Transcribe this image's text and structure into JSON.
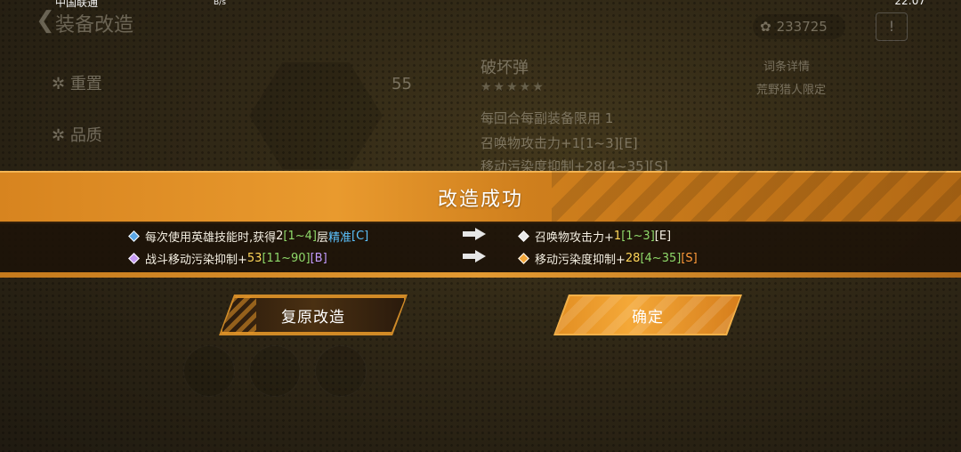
{
  "statusbar": {
    "carrier": "中国联通",
    "net": "B/s",
    "time": "22:07"
  },
  "background": {
    "title": "装备改造",
    "currency": "233725",
    "side_items": [
      "重置",
      "品质"
    ],
    "item_level": "55",
    "item_name": "破坏弹",
    "stars": "★★★★★",
    "detail_label": "词条详情",
    "limit_label": "荒野猎人限定",
    "affix_hint": "每回合每副装备限用 1",
    "affix_1": "召唤物攻击力+1[1~3][E]",
    "affix_2": "移动污染度抑制+28[4~35][S]"
  },
  "banner": {
    "title": "改造成功",
    "rows": [
      {
        "before_prefix": "每次使用英雄技能时,获得",
        "before_num": "2",
        "before_range": "[1~4]",
        "before_mid": "层",
        "before_kw": "精准",
        "before_grade": "[C]",
        "after_prefix": "召唤物攻击力+",
        "after_num": "1",
        "after_range": "[1~3]",
        "after_grade": "[E]"
      },
      {
        "before_prefix": "战斗移动污染抑制+",
        "before_num": "53",
        "before_range": "[11~90]",
        "before_grade": "[B]",
        "after_prefix": "移动污染度抑制+",
        "after_num": "28",
        "after_range": "[4~35]",
        "after_grade": "[S]"
      }
    ]
  },
  "buttons": {
    "restore": "复原改造",
    "confirm": "确定"
  },
  "colors": {
    "accent": "#e99a2e",
    "grade_c": "#5cc3ff",
    "grade_b": "#c39cff",
    "grade_s": "#ff9a3a"
  }
}
